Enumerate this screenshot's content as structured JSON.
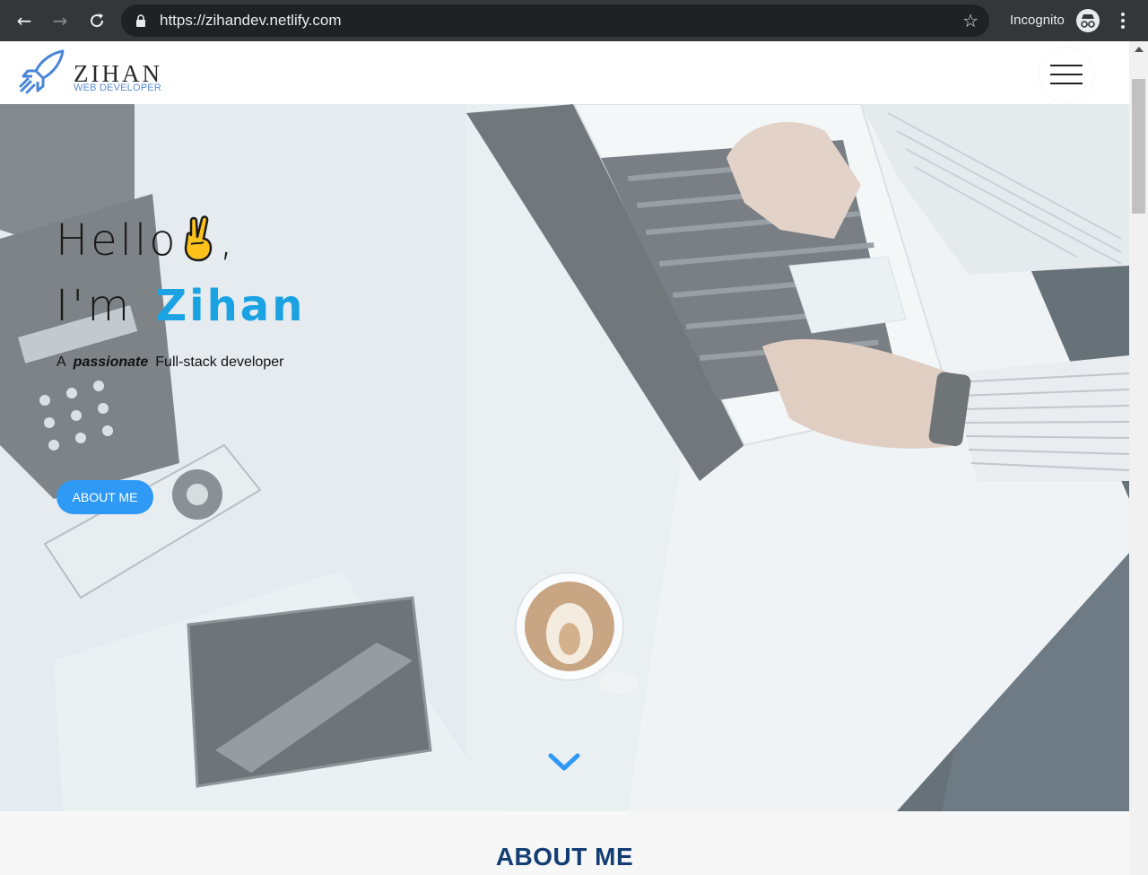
{
  "browser": {
    "url": "https://zihandev.netlify.com",
    "incognito_label": "Incognito"
  },
  "header": {
    "logo_title": "ZIHAN",
    "logo_subtitle": "WEB DEVELOPER"
  },
  "hero": {
    "hello": "Hello",
    "comma": ",",
    "im": "I'm",
    "name": "Zihan",
    "tagline_a": "A",
    "tagline_passionate": "passionate",
    "tagline_rest": "Full-stack developer",
    "button": "ABOUT ME"
  },
  "about": {
    "title": "ABOUT ME"
  },
  "colors": {
    "accent_blue": "#1ba2e3",
    "button_blue": "#2e9af5",
    "about_title": "#143e73",
    "logo_blue": "#4a86d8"
  },
  "icons": [
    "back-icon",
    "forward-icon",
    "reload-icon",
    "lock-icon",
    "star-icon",
    "incognito-icon",
    "menu-dots-icon",
    "rocket-logo-icon",
    "hamburger-icon",
    "peace-hand-emoji",
    "chevron-down-icon"
  ]
}
